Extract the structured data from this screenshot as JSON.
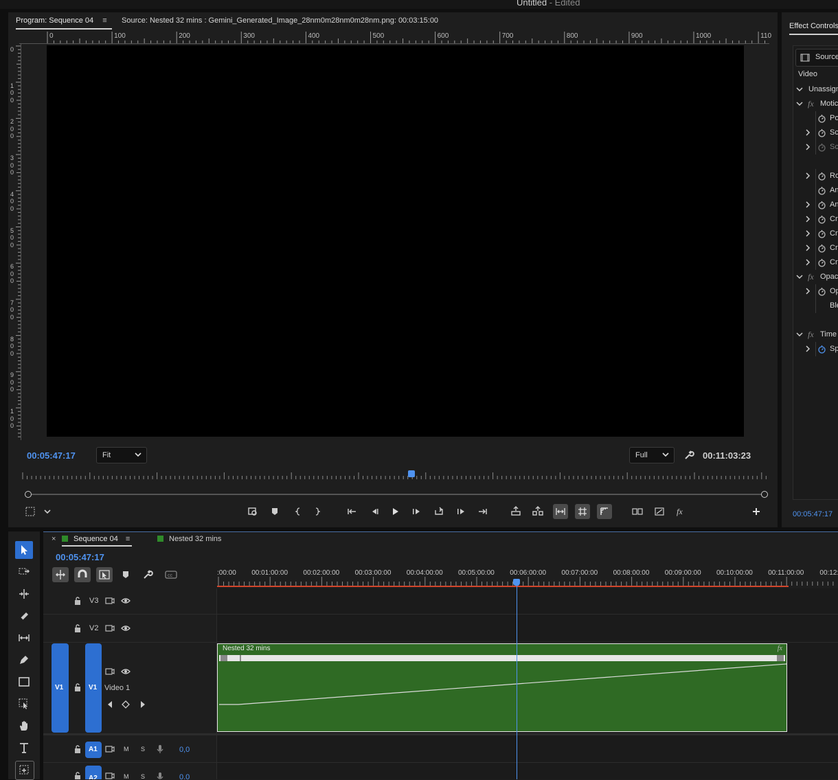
{
  "window": {
    "title": "Untitled",
    "title_suffix": " - Edited"
  },
  "program_monitor": {
    "tab_label": "Program: Sequence 04",
    "source_label": "Source: Nested 32 mins : Gemini_Generated_Image_28nm0m28nm0m28nm.png: 00:03:15:00",
    "h_ruler": [
      "0",
      "100",
      "200",
      "300",
      "400",
      "500",
      "600",
      "700",
      "800",
      "900",
      "1000",
      "110"
    ],
    "v_ruler": [
      [
        "0"
      ],
      [
        "1",
        "0",
        "0"
      ],
      [
        "2",
        "0",
        "0"
      ],
      [
        "3",
        "0",
        "0"
      ],
      [
        "4",
        "0",
        "0"
      ],
      [
        "5",
        "0",
        "0"
      ],
      [
        "6",
        "0",
        "0"
      ],
      [
        "7",
        "0",
        "0"
      ],
      [
        "8",
        "0",
        "0"
      ],
      [
        "9",
        "0",
        "0"
      ],
      [
        "1",
        "0",
        "0"
      ]
    ],
    "current_timecode": "00:05:47:17",
    "zoom_value": "Fit",
    "resolution_value": "Full",
    "duration_timecode": "00:11:03:23",
    "playhead_fraction": 0.522
  },
  "effect_controls": {
    "tab_label": "Effect Controls",
    "source_label": "Source",
    "video_label": "Video",
    "rows": [
      {
        "label": "Unassign",
        "type": "section"
      },
      {
        "label": "Motic",
        "type": "fx"
      },
      {
        "label": "Po",
        "type": "prop",
        "expand": false
      },
      {
        "label": "Sc",
        "type": "prop",
        "expand": true
      },
      {
        "label": "Sc",
        "type": "prop",
        "expand": true,
        "dim": true
      },
      {
        "label": "",
        "type": "blank"
      },
      {
        "label": "Ro",
        "type": "prop",
        "expand": true
      },
      {
        "label": "An",
        "type": "prop",
        "expand": false
      },
      {
        "label": "An",
        "type": "prop",
        "expand": true
      },
      {
        "label": "Cr",
        "type": "prop",
        "expand": true
      },
      {
        "label": "Cr",
        "type": "prop",
        "expand": true
      },
      {
        "label": "Cr",
        "type": "prop",
        "expand": true
      },
      {
        "label": "Cr",
        "type": "prop",
        "expand": true
      },
      {
        "label": "Opac",
        "type": "fx"
      },
      {
        "label": "Op",
        "type": "prop",
        "expand": true
      },
      {
        "label": "Ble",
        "type": "text"
      },
      {
        "label": "",
        "type": "blank"
      },
      {
        "label": "Time",
        "type": "fx"
      },
      {
        "label": "Sp",
        "type": "prop",
        "expand": true,
        "blue": true
      }
    ],
    "timecode": "00:05:47:17"
  },
  "timeline": {
    "tab_sequence": "Sequence 04",
    "tab_nested": "Nested 32 mins",
    "close_glyph": "×",
    "current_timecode": "00:05:47:17",
    "ruler_labels": [
      ":00:00",
      "00:01:00:00",
      "00:02:00:00",
      "00:03:00:00",
      "00:04:00:00",
      "00:05:00:00",
      "00:06:00:00",
      "00:07:00:00",
      "00:08:00:00",
      "00:09:00:00",
      "00:10:00:00",
      "00:11:00:00",
      "00:12:"
    ],
    "tracks": {
      "v3": "V3",
      "v2": "V2",
      "v1_source": "V1",
      "v1": "V1",
      "v1_name": "Video 1",
      "a1": "A1",
      "a2": "A2",
      "mute": "M",
      "solo": "S",
      "a1_volume": "0,0",
      "a2_volume": "0,0"
    },
    "clip": {
      "name": "Nested 32 mins",
      "fx_badge": "fx"
    },
    "colors": {
      "clip_green": "#2f6a24",
      "accent_blue": "#2d6fd1",
      "timecode_blue": "#4f93f0",
      "work_area_red": "#d2452b"
    }
  }
}
